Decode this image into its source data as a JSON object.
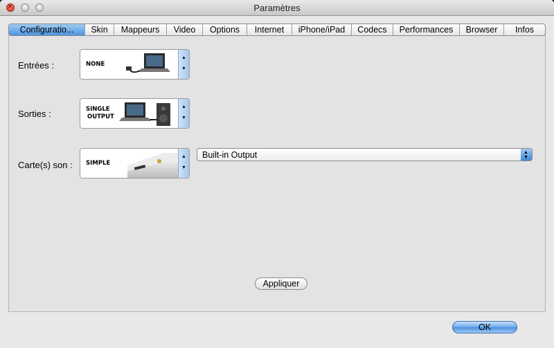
{
  "window": {
    "title": "Paramètres"
  },
  "tabs": [
    {
      "label": "Configuratio...",
      "active": true
    },
    {
      "label": "Skin"
    },
    {
      "label": "Mappeurs"
    },
    {
      "label": "Video"
    },
    {
      "label": "Options"
    },
    {
      "label": "Internet"
    },
    {
      "label": "iPhone/iPad"
    },
    {
      "label": "Codecs"
    },
    {
      "label": "Performances"
    },
    {
      "label": "Browser"
    },
    {
      "label": "Infos"
    }
  ],
  "config": {
    "inputs": {
      "label": "Entrées :",
      "value": "NONE"
    },
    "outputs": {
      "label": "Sorties :",
      "value_line1": "SINGLE",
      "value_line2": "OUTPUT"
    },
    "soundcard": {
      "label": "Carte(s) son :",
      "value": "SIMPLE",
      "device": "Built-in Output"
    }
  },
  "buttons": {
    "apply": "Appliquer",
    "ok": "OK"
  },
  "colors": {
    "accent": "#4c95e0",
    "window_bg": "#e8e8e8"
  }
}
